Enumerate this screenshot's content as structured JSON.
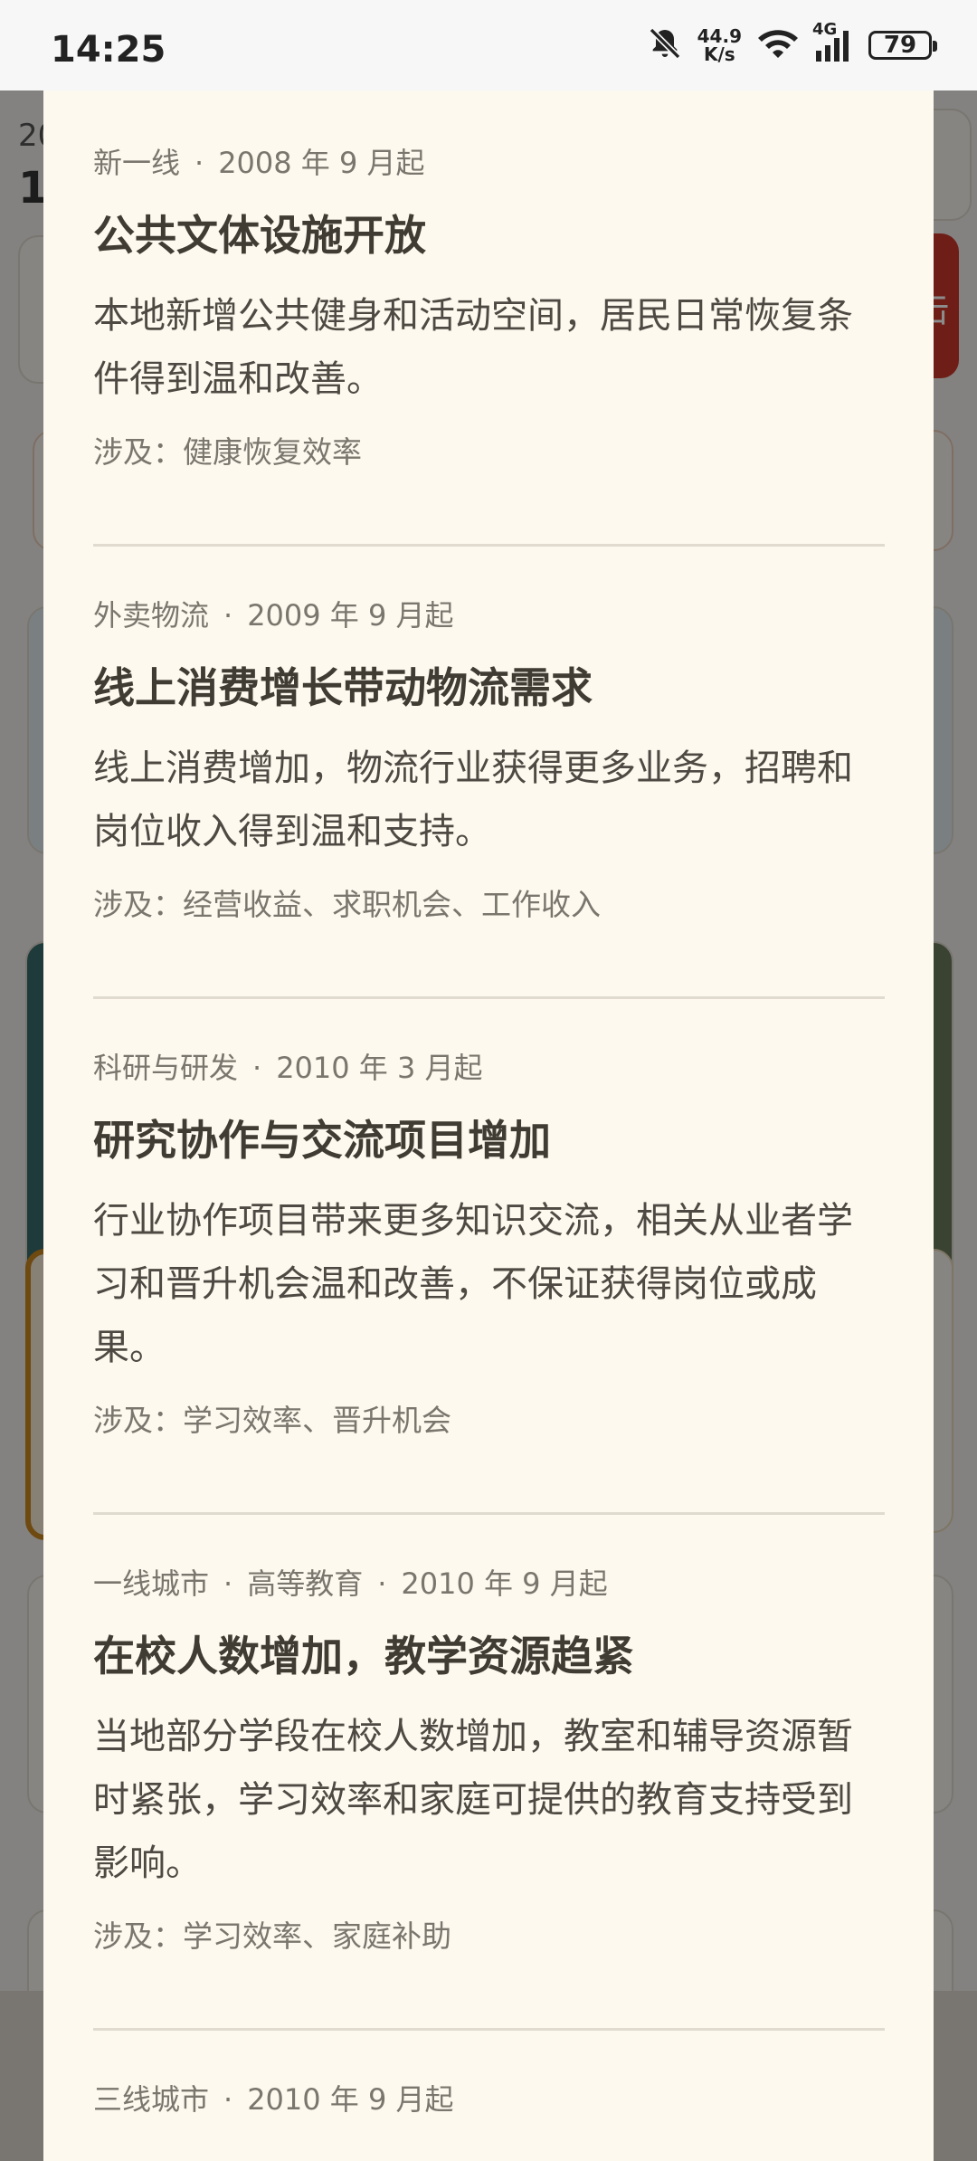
{
  "status_bar": {
    "time": "14:25",
    "net_speed_value": "44.9",
    "net_speed_unit": "K/s",
    "network": "4G",
    "battery": "79",
    "icons": [
      "bell-off-icon",
      "wifi-icon",
      "signal-icon",
      "battery-icon"
    ]
  },
  "background": {
    "partial_text_top": "20",
    "partial_text_second": "1",
    "partial_red_button_char": "击"
  },
  "sheet": {
    "events": [
      {
        "meta": [
          "新一线",
          "2008 年 9 月起"
        ],
        "title": "公共文体设施开放",
        "description": "本地新增公共健身和活动空间，居民日常恢复条件得到温和改善。",
        "involves": "涉及：健康恢复效率"
      },
      {
        "meta": [
          "外卖物流",
          "2009 年 9 月起"
        ],
        "title": "线上消费增长带动物流需求",
        "description": "线上消费增加，物流行业获得更多业务，招聘和岗位收入得到温和支持。",
        "involves": "涉及：经营收益、求职机会、工作收入"
      },
      {
        "meta": [
          "科研与研发",
          "2010 年 3 月起"
        ],
        "title": "研究协作与交流项目增加",
        "description": "行业协作项目带来更多知识交流，相关从业者学习和晋升机会温和改善，不保证获得岗位或成果。",
        "involves": "涉及：学习效率、晋升机会"
      },
      {
        "meta": [
          "一线城市",
          "高等教育",
          "2010 年 9 月起"
        ],
        "title": "在校人数增加，教学资源趋紧",
        "description": "当地部分学段在校人数增加，教室和辅导资源暂时紧张，学习效率和家庭可提供的教育支持受到影响。",
        "involves": "涉及：学习效率、家庭补助"
      },
      {
        "meta": [
          "三线城市",
          "2010 年 9 月起"
        ]
      }
    ]
  }
}
